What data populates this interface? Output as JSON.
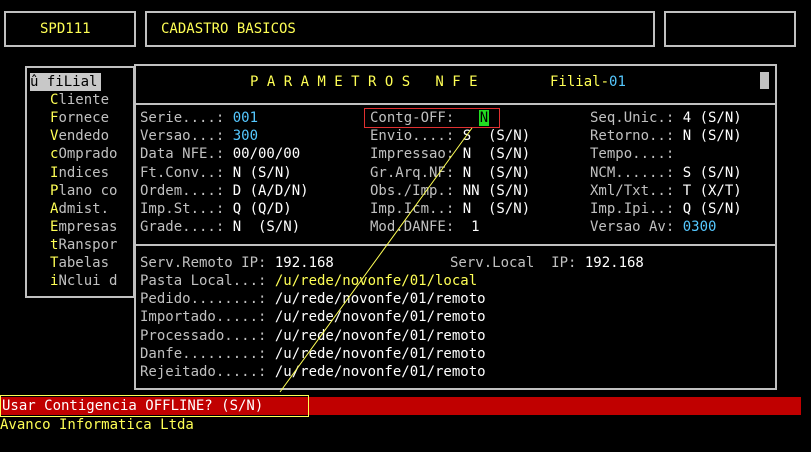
{
  "header": {
    "program": "SPD111",
    "title": "CADASTRO BASICOS"
  },
  "menu": {
    "items": [
      {
        "prefix": "û ",
        "hot": "",
        "label": "fiLial",
        "selected": true
      },
      {
        "hot": "C",
        "label": "liente"
      },
      {
        "hot": "F",
        "label": "ornece"
      },
      {
        "hot": "V",
        "label": "endedo"
      },
      {
        "hot": "c",
        "label": "Omprado"
      },
      {
        "hot": "I",
        "label": "ndices"
      },
      {
        "hot": "P",
        "label": "lano co"
      },
      {
        "hot": "A",
        "label": "dmist."
      },
      {
        "hot": "E",
        "label": "mpresas"
      },
      {
        "hot": "t",
        "label": "Ranspor"
      },
      {
        "hot": "T",
        "label": "abelas"
      },
      {
        "hot": "i",
        "label": "Nclui d"
      }
    ]
  },
  "panel": {
    "title": "P A R A M E T R O S   N F E",
    "filial_label": "Filial-",
    "filial_value": "01",
    "col1": [
      {
        "label": "Serie....: ",
        "value": "001",
        "value_color": "cyan"
      },
      {
        "label": "Versao...: ",
        "value": "300",
        "value_color": "cyan"
      },
      {
        "label": "Data NFE.: ",
        "value": "00/00/00"
      },
      {
        "label": "Ft.Conv..: ",
        "value": "N (S/N)"
      },
      {
        "label": "Ordem....: ",
        "value": "D (A/D/N)"
      },
      {
        "label": "Imp.St...: ",
        "value": "Q (Q/D)"
      },
      {
        "label": "Grade....: ",
        "value": "N  (S/N)"
      }
    ],
    "col2": [
      {
        "label": "Contg-OFF: ",
        "value": "N"
      },
      {
        "label": "Envio....: ",
        "value": "S  (S/N)"
      },
      {
        "label": "Impressao: ",
        "value": "N  (S/N)"
      },
      {
        "label": "Gr.Arq.NF: ",
        "value": "N  (S/N)"
      },
      {
        "label": "Obs./Imp.: ",
        "value": "NN (S/N)"
      },
      {
        "label": "Imp.Icm..: ",
        "value": "N  (S/N)"
      },
      {
        "label": "Mod.DANFE: ",
        "value": " 1"
      }
    ],
    "col3": [
      {
        "label": "Seq.Unic.: ",
        "value": "4 (S/N)"
      },
      {
        "label": "Retorno..: ",
        "value": "N (S/N)"
      },
      {
        "label": "Tempo....: ",
        "value": ""
      },
      {
        "label": "NCM......: ",
        "value": "S (S/N)"
      },
      {
        "label": "Xml/Txt..: ",
        "value": "T (X/T)"
      },
      {
        "label": "Imp.Ipi..: ",
        "value": "Q (S/N)"
      },
      {
        "label": "Versao Av: ",
        "value": "0300",
        "value_color": "cyan"
      }
    ],
    "serv_remoto_label": "Serv.Remoto IP: ",
    "serv_remoto_value": "192.168",
    "serv_local_label": "Serv.Local  IP: ",
    "serv_local_value": "192.168",
    "paths": [
      {
        "label": "Pasta Local...: ",
        "value": "/u/rede/novonfe/01/local",
        "value_color": "yellow"
      },
      {
        "label": "Pedido........: ",
        "value": "/u/rede/novonfe/01/remoto"
      },
      {
        "label": "Importado.....: ",
        "value": "/u/rede/novonfe/01/remoto"
      },
      {
        "label": "Processado....: ",
        "value": "/u/rede/novonfe/01/remoto"
      },
      {
        "label": "Danfe.........: ",
        "value": "/u/rede/novonfe/01/remoto"
      },
      {
        "label": "Rejeitado.....: ",
        "value": "/u/rede/novonfe/01/remoto"
      }
    ]
  },
  "prompt": "Usar Contigencia OFFLINE? (S/N)",
  "company": "Avanco Informatica Ltda",
  "colors": {
    "prompt_bar": "#c00000",
    "highlight_box": "#e03030",
    "cursor": "#22dd22",
    "annotation_line": "#ffff55"
  }
}
